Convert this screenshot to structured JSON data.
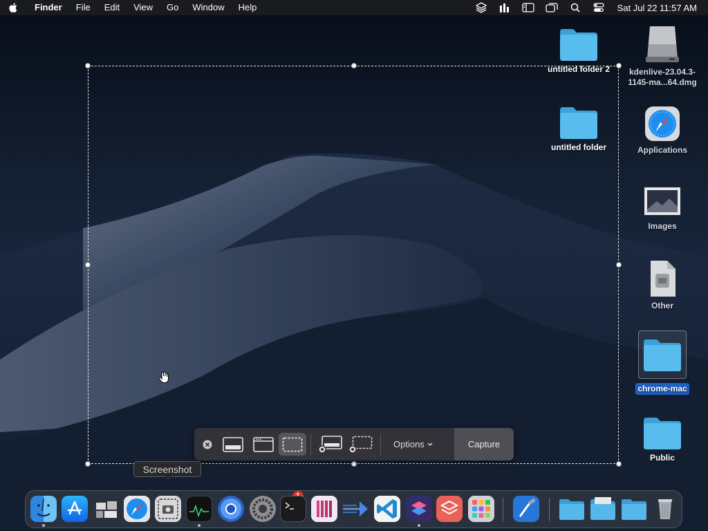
{
  "menubar": {
    "app_name": "Finder",
    "items": [
      "File",
      "Edit",
      "View",
      "Go",
      "Window",
      "Help"
    ],
    "clock": "Sat Jul 22  11:57 AM",
    "status_icons": [
      "layers-icon",
      "stats-icon",
      "sidebar-icon",
      "windows-icon",
      "search-icon",
      "control-center-icon"
    ]
  },
  "desktop_icons": [
    {
      "label": "untitled folder 2",
      "icon": "folder-icon"
    },
    {
      "label": "kdenlive-23.04.3-1145-ma...64.dmg",
      "icon": "disk-image-icon"
    },
    {
      "label": "untitled folder",
      "icon": "folder-icon"
    },
    {
      "label": "Applications",
      "icon": "safari-app-icon"
    },
    {
      "label": "Images",
      "icon": "image-icon"
    },
    {
      "label": "Other",
      "icon": "document-icon"
    },
    {
      "label": "chrome-mac",
      "icon": "folder-icon",
      "selected": true
    },
    {
      "label": "Public",
      "icon": "folder-icon"
    }
  ],
  "screenshot_toolbar": {
    "buttons": [
      "close-icon",
      "capture-entire-screen-icon",
      "capture-window-icon",
      "capture-selection-icon",
      "record-entire-screen-icon",
      "record-selection-icon"
    ],
    "active": "capture-selection-icon",
    "options_label": "Options",
    "capture_label": "Capture"
  },
  "tooltip": "Screenshot",
  "dock": {
    "apps": [
      "Finder",
      "App Store",
      "Mission Control",
      "Safari",
      "Screenshot",
      "Activity Monitor",
      "Chromium",
      "System Settings",
      "Terminal",
      "Slack",
      "Xcode Instruments",
      "Visual Studio Code",
      "Shortcuts",
      "Stack",
      "Launchpad",
      "Xcode"
    ],
    "system_settings_badge": "1",
    "folders": [
      "Downloads",
      "Documents",
      "Applications",
      "Trash"
    ]
  },
  "colors": {
    "accent": "#1f5fc4",
    "folder": "#4fb3e6",
    "badge": "#e0342b"
  }
}
